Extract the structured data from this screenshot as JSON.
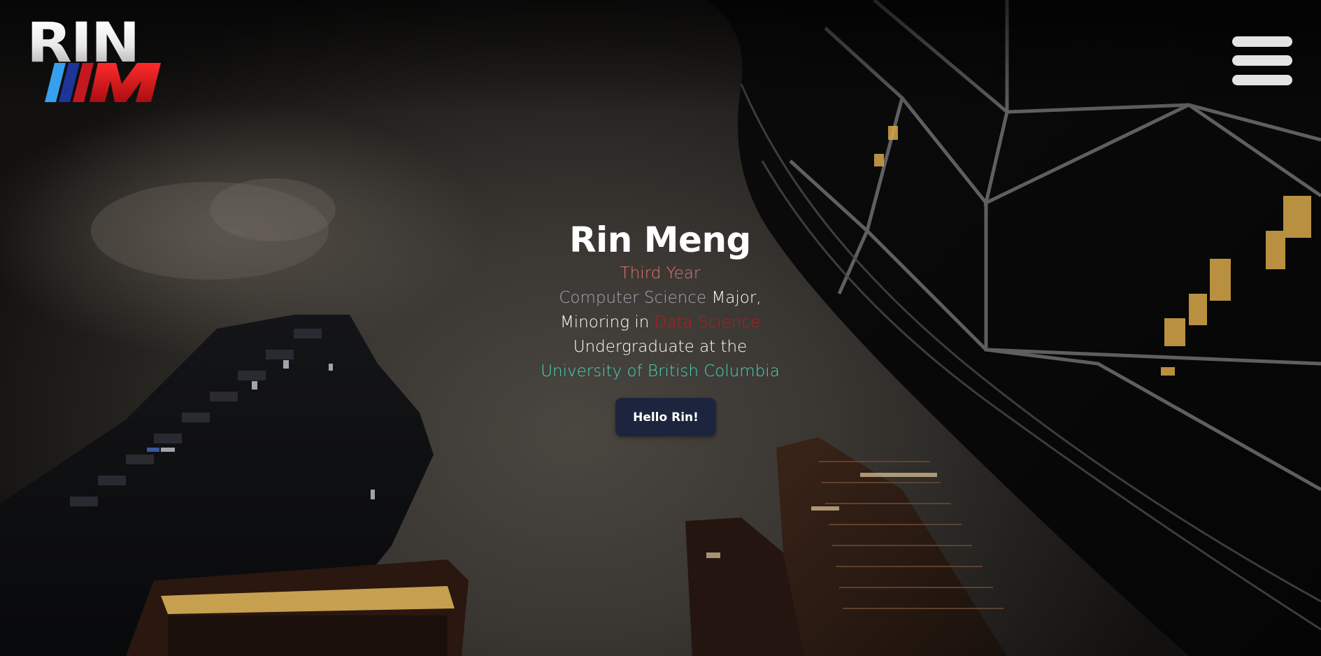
{
  "logo": {
    "top_text": "RIN",
    "bottom_text": "M",
    "stripe_colors": [
      "#2f8fe6",
      "#1b2f8f",
      "#d0151b"
    ]
  },
  "menu": {
    "icon": "hamburger-menu-icon"
  },
  "intro": {
    "name": "Rin Meng",
    "year": "Third Year",
    "major_highlight": "Computer Science",
    "major_suffix": " Major,",
    "minor_prefix": "Minoring in ",
    "minor_highlight": "Data Science",
    "undergrad_line": "Undergraduate at the",
    "university": "University of British Columbia"
  },
  "cta": {
    "label": "Hello Rin!"
  },
  "colors": {
    "year": "#e8736d",
    "major": "#a7a7b2",
    "minor": "#b41e1e",
    "university": "#49d4b4",
    "button_bg": "#1c253d"
  }
}
